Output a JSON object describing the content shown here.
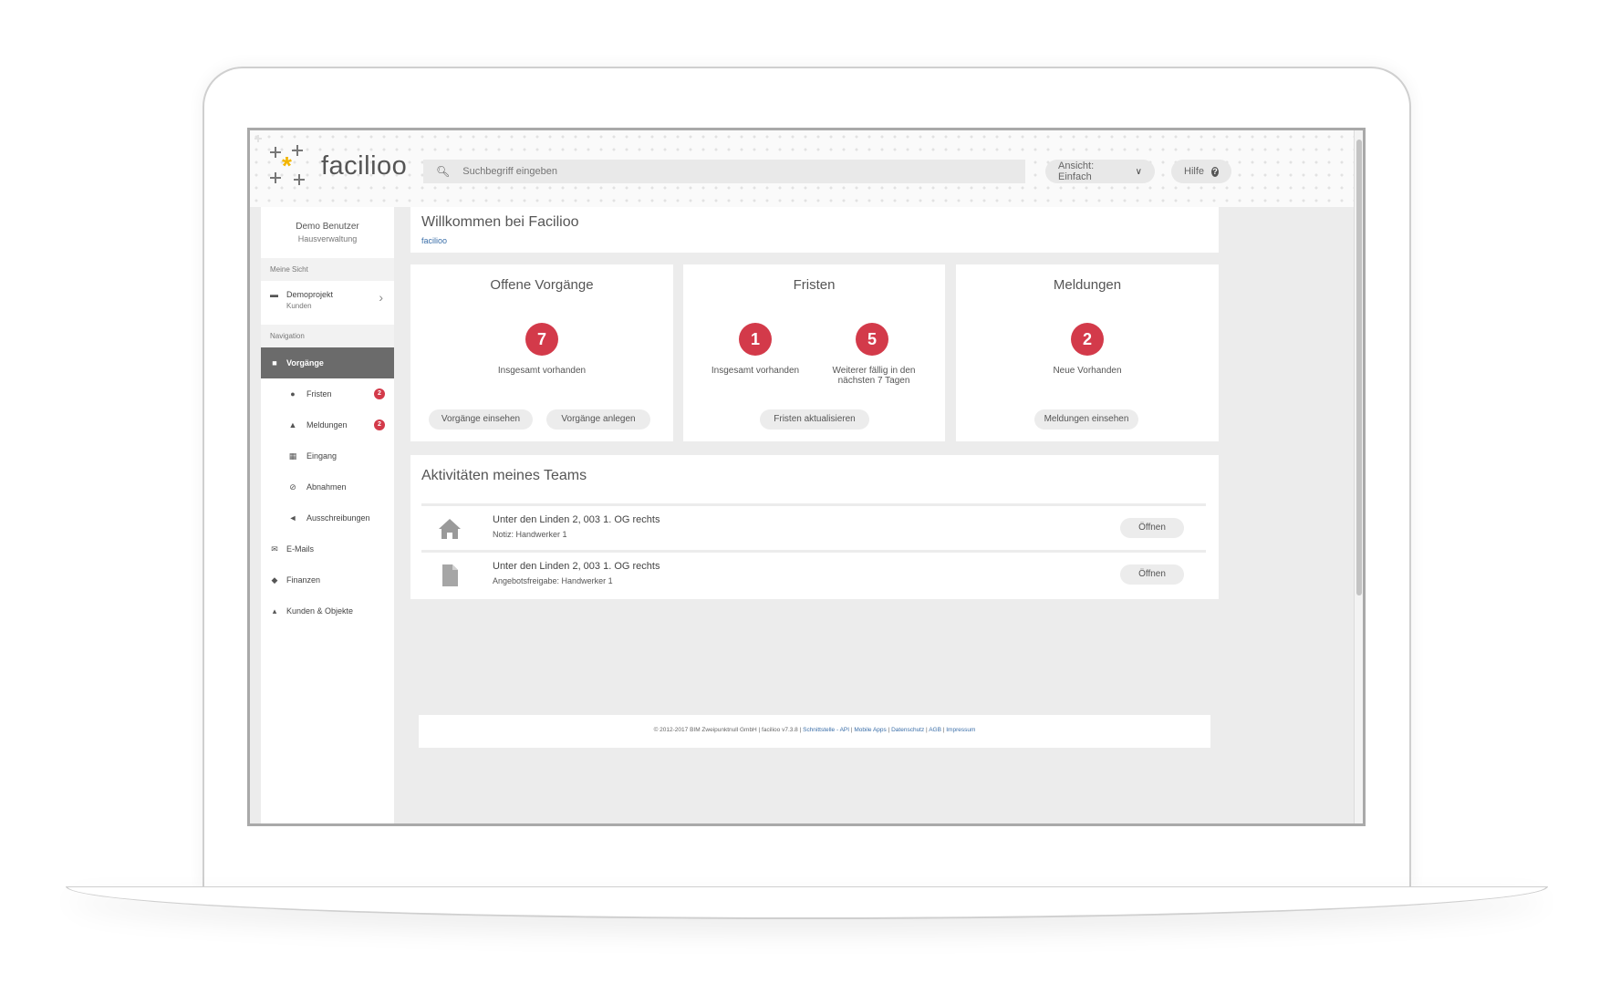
{
  "header": {
    "logo_text": "facilioo",
    "search_placeholder": "Suchbegriff eingeben",
    "view_label": "Ansicht: Einfach",
    "help_label": "Hilfe"
  },
  "sidebar": {
    "user_name": "Demo Benutzer",
    "user_role": "Hausverwaltung",
    "section_my_view": "Meine Sicht",
    "project_name": "Demoprojekt",
    "project_sub": "Kunden",
    "section_navigation": "Navigation",
    "items": [
      {
        "label": "Vorgänge",
        "icon": "document-icon",
        "active": true
      },
      {
        "label": "Fristen",
        "icon": "clock-icon",
        "badge": "2"
      },
      {
        "label": "Meldungen",
        "icon": "bell-icon",
        "badge": "2"
      },
      {
        "label": "Eingang",
        "icon": "inbox-icon"
      },
      {
        "label": "Abnahmen",
        "icon": "check-circle-icon"
      },
      {
        "label": "Ausschreibungen",
        "icon": "megaphone-icon"
      },
      {
        "label": "E-Mails",
        "icon": "envelope-icon"
      },
      {
        "label": "Finanzen",
        "icon": "money-icon"
      },
      {
        "label": "Kunden & Objekte",
        "icon": "cloud-icon"
      }
    ]
  },
  "welcome": {
    "title": "Willkommen bei Facilioo",
    "breadcrumb": "facilioo"
  },
  "cards": {
    "open_tasks": {
      "title": "Offene Vorgänge",
      "count": "7",
      "caption": "Insgesamt vorhanden",
      "btn_view": "Vorgänge einsehen",
      "btn_create": "Vorgänge anlegen"
    },
    "deadlines": {
      "title": "Fristen",
      "count_total": "1",
      "caption_total": "Insgesamt vorhanden",
      "count_due": "5",
      "caption_due": "Weiterer fällig in den nächsten 7 Tagen",
      "btn_update": "Fristen aktualisieren"
    },
    "reports": {
      "title": "Meldungen",
      "count": "2",
      "caption": "Neue Vorhanden",
      "btn_view": "Meldungen einsehen"
    }
  },
  "team": {
    "title": "Aktivitäten meines Teams",
    "rows": [
      {
        "icon": "house-icon",
        "title": "Unter den Linden 2, 003 1. OG rechts",
        "subtitle": "Notiz: Handwerker 1",
        "action": "Öffnen"
      },
      {
        "icon": "document-icon",
        "title": "Unter den Linden 2, 003 1. OG rechts",
        "subtitle": "Angebotsfreigabe: Handwerker 1",
        "action": "Öffnen"
      }
    ]
  },
  "footer": {
    "copyright": "© 2012-2017 BIM Zweipunktnull GmbH | facilioo v7.3.8 |",
    "link_api": "Schnittstelle - API",
    "link_apps": "Mobile Apps",
    "link_privacy": "Datenschutz",
    "link_terms": "AGB",
    "link_imprint": "Impressum"
  },
  "colors": {
    "accent_red": "#d33a4a",
    "logo_yellow": "#f2b500",
    "active_nav": "#6b6b6b"
  }
}
